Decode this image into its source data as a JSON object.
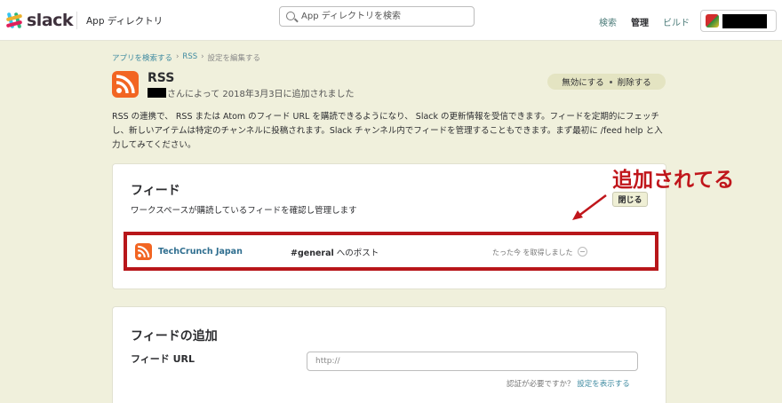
{
  "header": {
    "logo_text": "slack",
    "app_directory": "App ディレクトリ",
    "search_placeholder": "App ディレクトリを検索",
    "nav": [
      "検索",
      "管理",
      "ビルド"
    ]
  },
  "breadcrumb": [
    "アプリを検索する",
    "›",
    "RSS",
    "›",
    "設定を編集する"
  ],
  "app": {
    "title": "RSS",
    "added_by": "さんによって 2018年3月3日に追加されました",
    "disable": "無効にする",
    "remove": "削除する"
  },
  "description": "RSS の連携で、 RSS または Atom のフィード URL を購読できるようになり、 Slack の更新情報を受信できます。フィードを定期的にフェッチし、新しいアイテムは特定のチャンネルに投稿されます。Slack チャンネル内でフィードを管理することもできます。まず最初に /feed help と入力してみてください。",
  "feeds_card": {
    "title": "フィード",
    "subtitle": "ワークスペースが購読しているフィードを確認し管理します",
    "close": "閉じる",
    "items": [
      {
        "name": "TechCrunch Japan",
        "channel": "#general",
        "channel_suffix": " へのポスト",
        "status": "たった今 を取得しました"
      }
    ]
  },
  "add_card": {
    "title": "フィードの追加",
    "url_label": "フィード URL",
    "url_placeholder": "http://",
    "auth_text": "認証が必要ですか？",
    "auth_link": "設定を表示する"
  },
  "annotation": "追加されてる",
  "colors": {
    "background": "#f0f0dc",
    "rss_orange": "#f26522",
    "annotation_red": "#c0161b",
    "link": "#3e8aa0"
  }
}
